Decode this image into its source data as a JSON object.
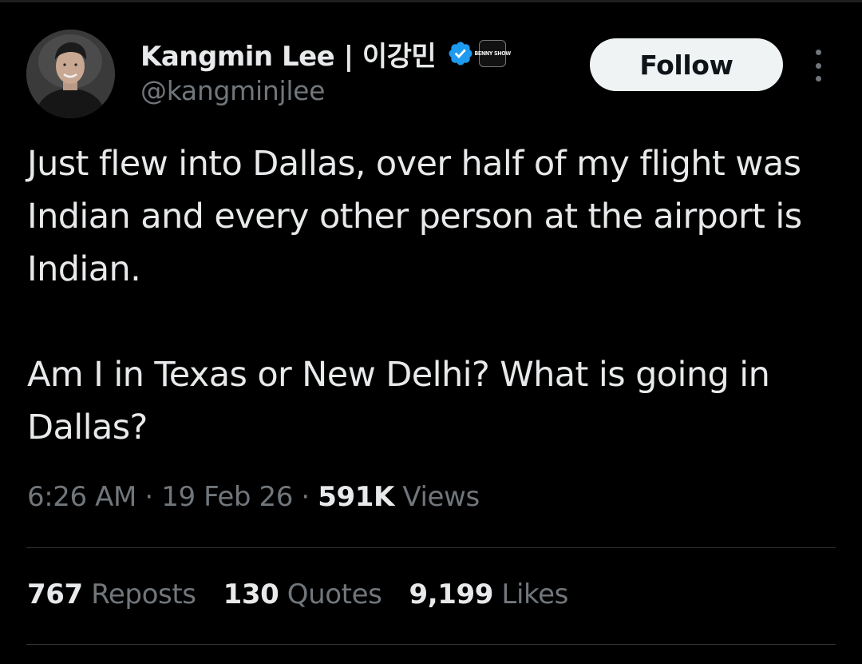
{
  "colors": {
    "background": "#000000",
    "primary_text": "#e7e9ea",
    "secondary_text": "#71767b",
    "verified_blue": "#1d9bf0",
    "follow_button_bg": "#eff3f4",
    "divider": "#2f3336"
  },
  "author": {
    "display_name": "Kangmin Lee | 이강민",
    "handle": "@kangminjlee",
    "avatar_icon": "profile-photo",
    "verified_icon": "verified-badge-icon",
    "affiliate_badge_icon": "benny-show-badge-icon",
    "affiliate_badge_text": "BENNY SHOW"
  },
  "actions": {
    "follow_label": "Follow",
    "more_icon": "more-options-icon"
  },
  "tweet": {
    "text": "Just flew into Dallas, over half of my flight was Indian and every other person at the airport is Indian.\n\nAm I in Texas or New Delhi? What is going in Dallas?",
    "time": "6:26 AM",
    "separator": "·",
    "date": "19 Feb 26",
    "views_count": "591K",
    "views_label": "Views"
  },
  "stats": [
    {
      "count": "767",
      "label": "Reposts"
    },
    {
      "count": "130",
      "label": "Quotes"
    },
    {
      "count": "9,199",
      "label": "Likes"
    }
  ]
}
